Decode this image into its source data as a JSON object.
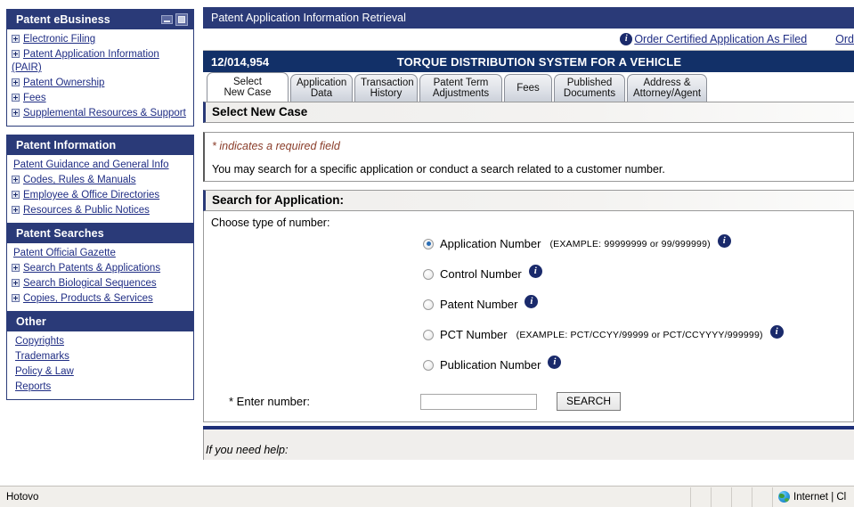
{
  "sidebar": {
    "panels": [
      {
        "title": "Patent eBusiness",
        "has_window_buttons": true,
        "items": [
          {
            "label": "Electronic Filing",
            "expandable": true
          },
          {
            "label": "Patent Application Information (PAIR)",
            "expandable": true
          },
          {
            "label": "Patent Ownership",
            "expandable": true
          },
          {
            "label": "Fees",
            "expandable": true
          },
          {
            "label": "Supplemental Resources & Support",
            "expandable": true
          }
        ]
      },
      {
        "title": "Patent Information",
        "has_window_buttons": false,
        "items": [
          {
            "label": "Patent Guidance and General Info",
            "expandable": false
          },
          {
            "label": "Codes, Rules & Manuals",
            "expandable": true
          },
          {
            "label": "Employee & Office Directories",
            "expandable": true
          },
          {
            "label": "Resources & Public Notices",
            "expandable": true
          }
        ]
      },
      {
        "title": "Patent Searches",
        "has_window_buttons": false,
        "items": [
          {
            "label": "Patent Official Gazette",
            "expandable": false
          },
          {
            "label": "Search Patents & Applications",
            "expandable": true
          },
          {
            "label": "Search Biological Sequences",
            "expandable": true
          },
          {
            "label": "Copies, Products & Services",
            "expandable": true
          }
        ]
      },
      {
        "title": "Other",
        "has_window_buttons": false,
        "items": [
          {
            "label": "Copyrights",
            "expandable": false
          },
          {
            "label": "Trademarks",
            "expandable": false
          },
          {
            "label": "Policy & Law",
            "expandable": false
          },
          {
            "label": "Reports",
            "expandable": false
          }
        ]
      }
    ]
  },
  "main": {
    "app_title": "Patent Application Information Retrieval",
    "order_links": [
      {
        "label": "Order Certified Application As Filed",
        "icon": "info-icon"
      },
      {
        "label": "Ord",
        "icon": null
      }
    ],
    "application_number": "12/014,954",
    "application_title": "TORQUE DISTRIBUTION SYSTEM FOR A VEHICLE",
    "tabs": [
      {
        "line1": "Select",
        "line2": "New Case",
        "active": true
      },
      {
        "line1": "Application",
        "line2": "Data",
        "active": false
      },
      {
        "line1": "Transaction",
        "line2": "History",
        "active": false
      },
      {
        "line1": "Patent Term",
        "line2": "Adjustments",
        "active": false
      },
      {
        "line1": "Fees",
        "line2": "",
        "active": false
      },
      {
        "line1": "Published",
        "line2": "Documents",
        "active": false
      },
      {
        "line1": "Address &",
        "line2": "Attorney/Agent",
        "active": false
      }
    ],
    "page_heading": "Select New Case",
    "required_note": "* indicates a required field",
    "intro_text": "You may search for a specific application or conduct a search related to a customer number.",
    "search_heading": "Search for Application:",
    "choose_label": "Choose type of number:",
    "radios": [
      {
        "label": "Application Number",
        "example": "(EXAMPLE: 99999999 or 99/999999)",
        "selected": true
      },
      {
        "label": "Control Number",
        "example": "",
        "selected": false
      },
      {
        "label": "Patent Number",
        "example": "",
        "selected": false
      },
      {
        "label": "PCT Number",
        "example": "(EXAMPLE: PCT/CCYY/99999 or PCT/CCYYYY/999999)",
        "selected": false
      },
      {
        "label": "Publication Number",
        "example": "",
        "selected": false
      }
    ],
    "enter_number_label": "* Enter number:",
    "enter_number_value": "",
    "enter_number_placeholder": "",
    "search_button": "SEARCH",
    "help_text": "If you need help:"
  },
  "statusbar": {
    "message": "Hotovo",
    "zone": "Internet | Cl"
  },
  "colors": {
    "navy_header": "#2a3a78",
    "navy_appbar": "#123068",
    "link": "#1f2d84",
    "required_red": "#8a3d2a",
    "rule_blue": "#1e2f78"
  }
}
